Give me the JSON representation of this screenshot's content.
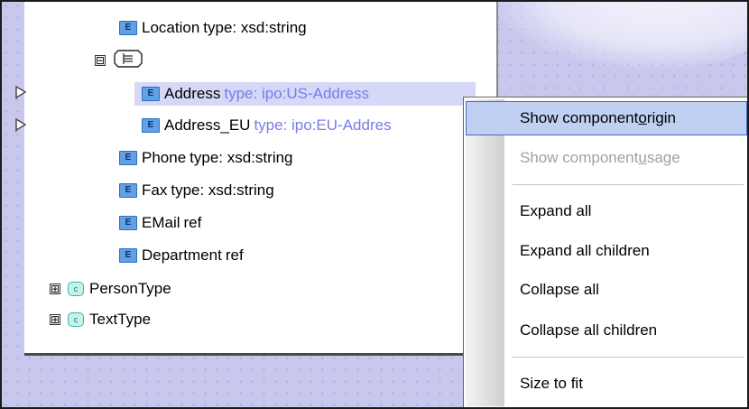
{
  "schema_tree": {
    "rows": [
      {
        "label": "Location",
        "type": "type: xsd:string"
      },
      {
        "label": "Address",
        "type": "type: ipo:US-Address"
      },
      {
        "label": "Address_EU",
        "type": "type: ipo:EU-Addres"
      },
      {
        "label": "Phone",
        "type": "type: xsd:string"
      },
      {
        "label": "Fax",
        "type": "type: xsd:string"
      },
      {
        "label": "EMail",
        "type": "ref"
      },
      {
        "label": "Department",
        "type": "ref"
      },
      {
        "label": "PersonType"
      },
      {
        "label": "TextType"
      }
    ],
    "badge_element": "E",
    "badge_complex": "c",
    "expand_glyph": "⊞",
    "collapse_glyph": "⊟"
  },
  "context_menu": {
    "items": [
      {
        "pre": "Show component ",
        "mnemonic": "o",
        "post": "rigin",
        "state": "highlighted"
      },
      {
        "pre": "Show component ",
        "mnemonic": "u",
        "post": "sage",
        "state": "disabled"
      },
      {
        "label": "Expand all"
      },
      {
        "label": "Expand all children"
      },
      {
        "label": "Collapse all"
      },
      {
        "label": "Collapse all children"
      },
      {
        "label": "Size to fit"
      }
    ]
  },
  "colors": {
    "canvas": "#c8c8ee",
    "type_text": "#7a7aea",
    "menu_highlight": "#bfd0f2",
    "selection": "#d5d9f7"
  },
  "icons": {
    "port": "port-arrow-icon",
    "element": "element-badge-icon",
    "complex_type": "complex-type-icon",
    "sequence": "sequence-compositor-icon"
  }
}
